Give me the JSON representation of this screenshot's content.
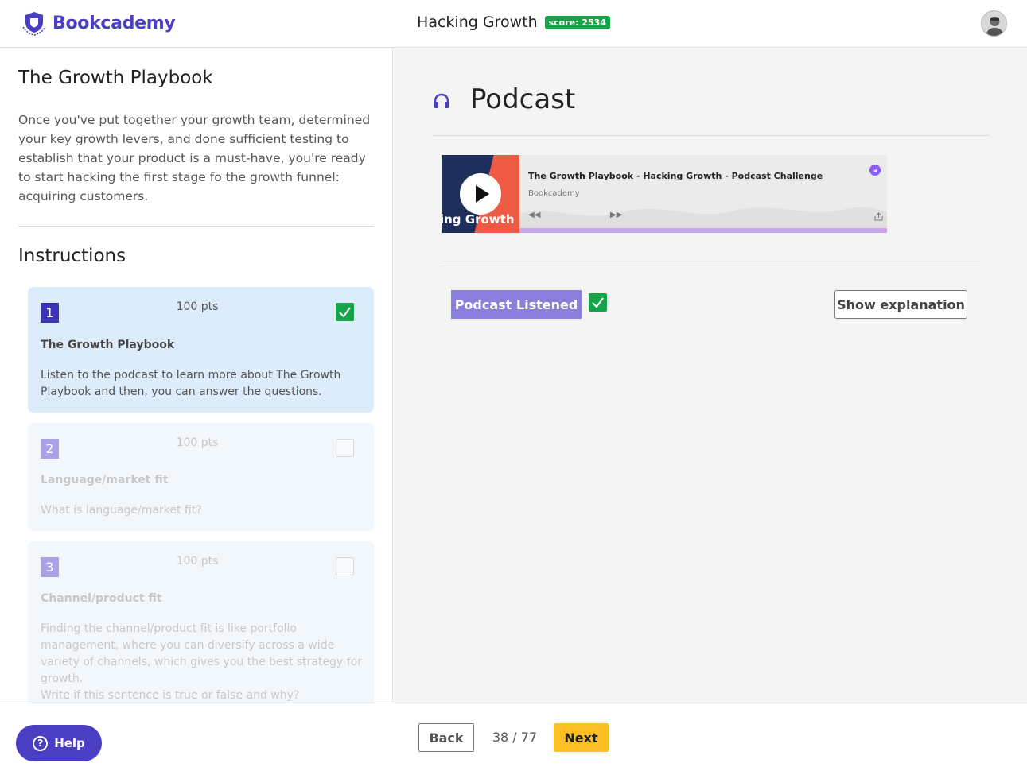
{
  "header": {
    "brand": "Bookcademy",
    "course_title": "Hacking Growth",
    "score": "score: 2534"
  },
  "chapter": {
    "title": "The Growth Playbook",
    "description": "Once you've put together your growth team, determined your key growth levers, and done sufficient testing to establish that your product is a must-have, you're ready to start hacking the first stage fo the growth funnel: acquiring customers."
  },
  "instructions": {
    "heading": "Instructions",
    "items": [
      {
        "number": "1",
        "points": "100 pts",
        "title": "The Growth Playbook",
        "description": "Listen to the podcast to learn more about The Growth Playbook and then, you can answer the questions.",
        "completed": true
      },
      {
        "number": "2",
        "points": "100 pts",
        "title": "Language/market fit",
        "description": "What is language/market fit?",
        "completed": false
      },
      {
        "number": "3",
        "points": "100 pts",
        "title": "Channel/product fit",
        "description": "Finding the channel/product fit is like portfolio management, where you can diversify across a wide variety of channels, which gives you the best strategy for growth.",
        "description2": "Write if this sentence is true or false and why?",
        "completed": false
      }
    ]
  },
  "main": {
    "section_title": "Podcast",
    "player": {
      "episode_title": "The Growth Playbook - Hacking Growth - Podcast Challenge",
      "author": "Bookcademy",
      "cover_text": "king Growth",
      "rewind_icon": "rewind-icon",
      "forward_icon": "fast-forward-icon"
    },
    "listened_button": "Podcast Listened",
    "explanation_button": "Show explanation"
  },
  "footer": {
    "help_label": "Help",
    "back_label": "Back",
    "page_indicator": "38 / 77",
    "next_label": "Next"
  },
  "colors": {
    "brand": "#4a3fc2",
    "success": "#16a34a",
    "accent_next": "#fbbf24",
    "listened_button": "#8a7fdc"
  }
}
